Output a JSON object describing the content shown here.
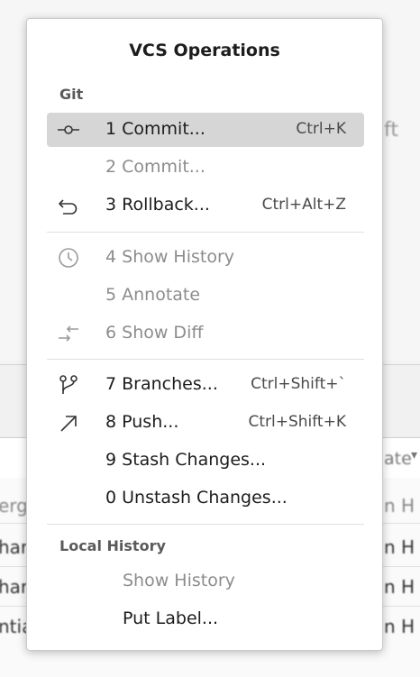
{
  "background": {
    "fragments": [
      "ft",
      "ate",
      "erg",
      "n H",
      "har",
      "n H",
      "har",
      "n H",
      "ntia",
      "n H"
    ]
  },
  "popup": {
    "title": "VCS Operations",
    "groups": [
      {
        "label": "Git",
        "items": [
          {
            "label": "1 Commit...",
            "shortcut": "Ctrl+K",
            "icon": "commit-icon",
            "selected": true,
            "enabled": true
          },
          {
            "label": "2 Commit...",
            "shortcut": "",
            "icon": "",
            "selected": false,
            "enabled": false
          },
          {
            "label": "3 Rollback...",
            "shortcut": "Ctrl+Alt+Z",
            "icon": "rollback-icon",
            "selected": false,
            "enabled": true
          },
          {
            "label": "4 Show History",
            "shortcut": "",
            "icon": "history-icon",
            "selected": false,
            "enabled": false
          },
          {
            "label": "5 Annotate",
            "shortcut": "",
            "icon": "",
            "selected": false,
            "enabled": false
          },
          {
            "label": "6 Show Diff",
            "shortcut": "",
            "icon": "diff-icon",
            "selected": false,
            "enabled": false
          },
          {
            "label": "7 Branches...",
            "shortcut": "Ctrl+Shift+`",
            "icon": "branch-icon",
            "selected": false,
            "enabled": true
          },
          {
            "label": "8 Push...",
            "shortcut": "Ctrl+Shift+K",
            "icon": "push-icon",
            "selected": false,
            "enabled": true
          },
          {
            "label": "9 Stash Changes...",
            "shortcut": "",
            "icon": "",
            "selected": false,
            "enabled": true
          },
          {
            "label": "0 Unstash Changes...",
            "shortcut": "",
            "icon": "",
            "selected": false,
            "enabled": true
          }
        ]
      },
      {
        "label": "Local History",
        "items": [
          {
            "label": "Show History",
            "shortcut": "",
            "icon": "",
            "selected": false,
            "enabled": false
          },
          {
            "label": "Put Label...",
            "shortcut": "",
            "icon": "",
            "selected": false,
            "enabled": true
          }
        ]
      }
    ]
  }
}
